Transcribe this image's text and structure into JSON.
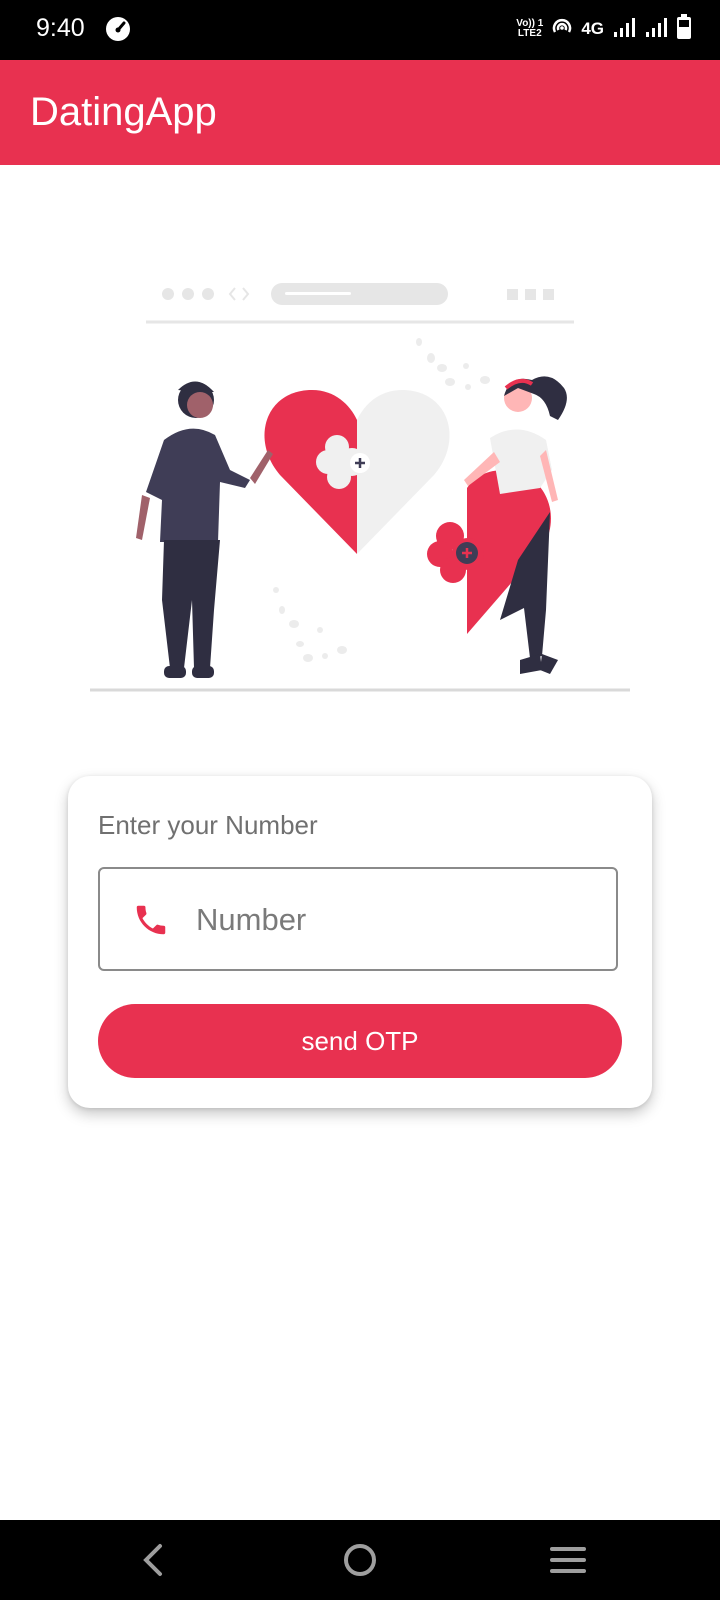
{
  "status_bar": {
    "time": "9:40",
    "volte_line1": "Vo)) 1",
    "volte_line2": "LTE2",
    "network": "4G",
    "icons": [
      "speedometer-icon",
      "volte-icon",
      "hotspot-icon",
      "signal-icon",
      "signal-icon",
      "battery-icon"
    ]
  },
  "app_bar": {
    "title": "DatingApp",
    "color": "#e83150"
  },
  "illustration": {
    "name": "couple-heart-puzzle-illustration"
  },
  "login_card": {
    "heading": "Enter your Number",
    "phone_input": {
      "placeholder": "Number",
      "value": "",
      "icon": "phone-icon"
    },
    "send_button_label": "send OTP"
  },
  "nav_bar": {
    "icons": [
      "back-icon",
      "home-icon",
      "menu-icon"
    ]
  },
  "colors": {
    "accent": "#e83150",
    "text_secondary": "#707070",
    "status_bg": "#000000"
  }
}
